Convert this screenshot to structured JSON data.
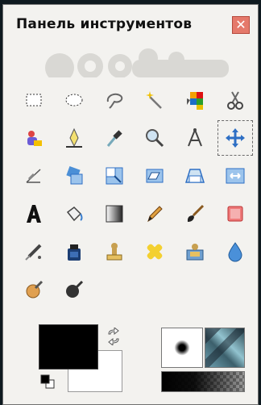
{
  "window": {
    "title": "Панель инструментов",
    "close_label": "✕"
  },
  "tools": [
    {
      "name": "rect-select-icon"
    },
    {
      "name": "ellipse-select-icon"
    },
    {
      "name": "free-select-icon"
    },
    {
      "name": "fuzzy-select-icon"
    },
    {
      "name": "select-by-color-icon"
    },
    {
      "name": "scissors-select-icon"
    },
    {
      "name": "foreground-select-icon"
    },
    {
      "name": "paths-icon"
    },
    {
      "name": "color-picker-icon"
    },
    {
      "name": "zoom-icon"
    },
    {
      "name": "measure-icon"
    },
    {
      "name": "move-icon",
      "active": true
    },
    {
      "name": "align-icon"
    },
    {
      "name": "rotate-icon"
    },
    {
      "name": "scale-icon"
    },
    {
      "name": "shear-icon"
    },
    {
      "name": "perspective-icon"
    },
    {
      "name": "flip-icon"
    },
    {
      "name": "text-icon"
    },
    {
      "name": "bucket-fill-icon"
    },
    {
      "name": "blend-icon"
    },
    {
      "name": "pencil-icon"
    },
    {
      "name": "paintbrush-icon"
    },
    {
      "name": "eraser-icon"
    },
    {
      "name": "airbrush-icon"
    },
    {
      "name": "ink-icon"
    },
    {
      "name": "clone-icon"
    },
    {
      "name": "heal-icon"
    },
    {
      "name": "perspective-clone-icon"
    },
    {
      "name": "blur-sharpen-icon"
    },
    {
      "name": "smudge-icon"
    },
    {
      "name": "dodge-burn-icon"
    }
  ],
  "colors": {
    "foreground": "#000000",
    "background": "#ffffff"
  }
}
